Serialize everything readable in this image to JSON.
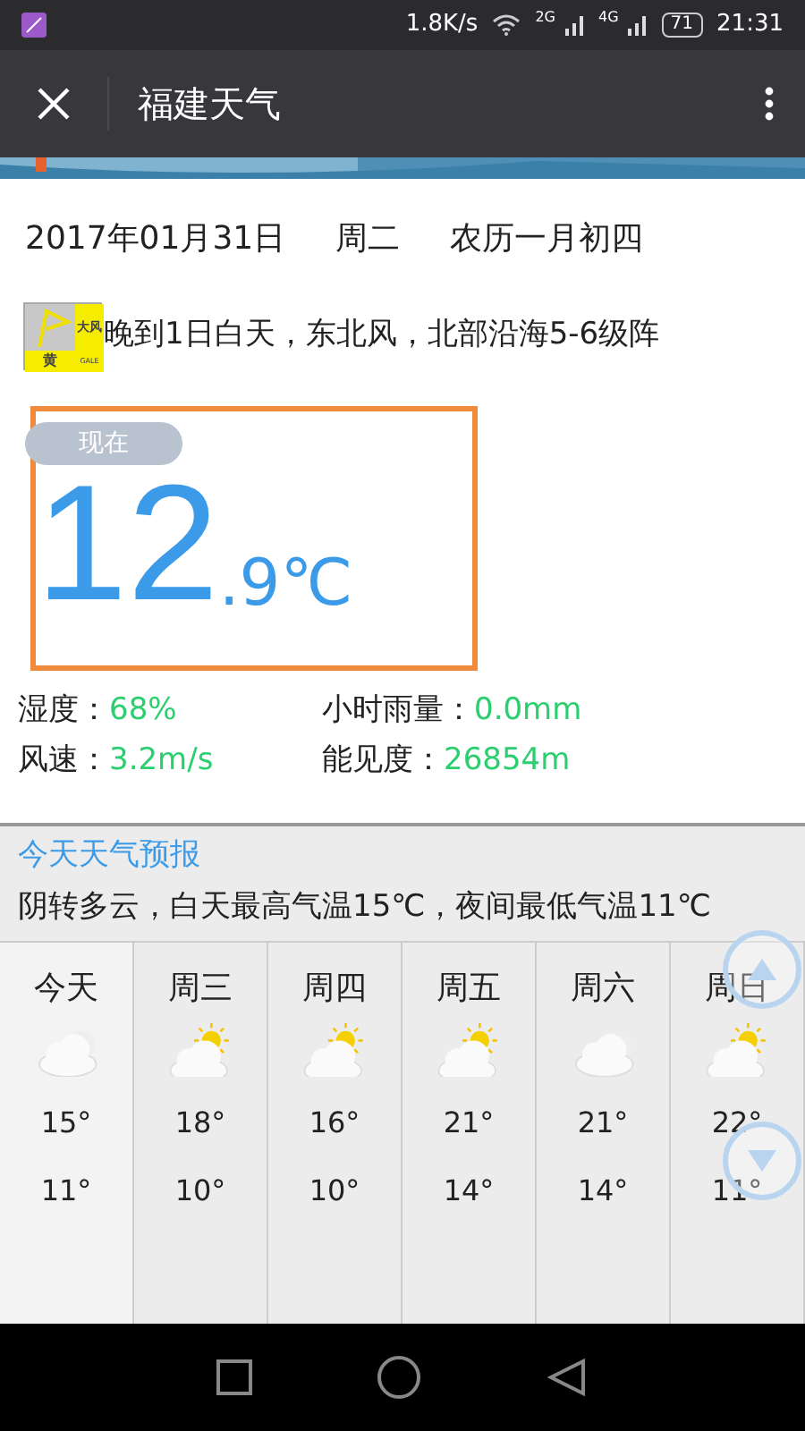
{
  "status_bar": {
    "speed": "1.8K/s",
    "net1": "2G",
    "net2": "4G",
    "battery": "71",
    "time": "21:31"
  },
  "toolbar": {
    "title": "福建天气"
  },
  "date_line": {
    "date": "2017年01月31日",
    "weekday": "周二",
    "lunar": "农历一月初四"
  },
  "alert": {
    "icon_top": "大风",
    "icon_bottom": "黄",
    "icon_code": "GALE",
    "text": "晚到1日白天，东北风，北部沿海5-6级阵"
  },
  "now": {
    "label": "现在",
    "temp_int": "12",
    "temp_dec": ".9℃"
  },
  "stats": [
    {
      "label": "湿度：",
      "value": "68%"
    },
    {
      "label": "小时雨量：",
      "value": "0.0mm"
    },
    {
      "label": "风速：",
      "value": "3.2m/s"
    },
    {
      "label": "能见度：",
      "value": "26854m"
    }
  ],
  "today": {
    "title": "今天天气预报",
    "text": "阴转多云，白天最高气温15℃，夜间最低气温11℃"
  },
  "forecast": [
    {
      "day": "今天",
      "kind": "cloudy",
      "high": "15°",
      "low": "11°"
    },
    {
      "day": "周三",
      "kind": "partly_sunny",
      "high": "18°",
      "low": "10°"
    },
    {
      "day": "周四",
      "kind": "partly_sunny",
      "high": "16°",
      "low": "10°"
    },
    {
      "day": "周五",
      "kind": "partly_sunny",
      "high": "21°",
      "low": "14°"
    },
    {
      "day": "周六",
      "kind": "cloudy",
      "high": "21°",
      "low": "14°"
    },
    {
      "day": "周日",
      "kind": "partly_sunny",
      "high": "22°",
      "low": "11°"
    }
  ]
}
